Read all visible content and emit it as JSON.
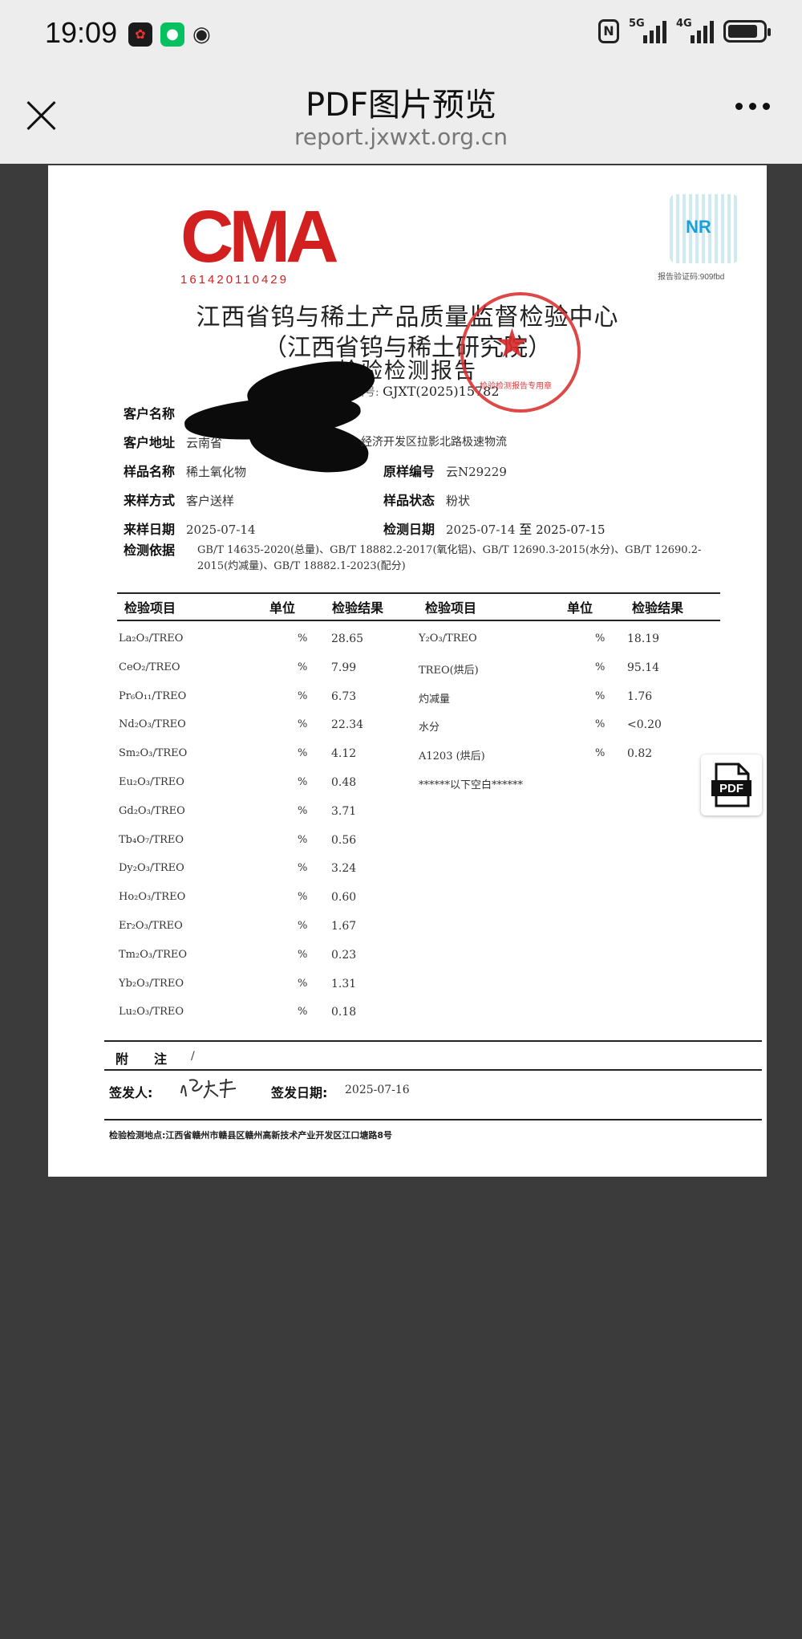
{
  "status_bar": {
    "time": "19:09",
    "network1": "5G",
    "network2": "4G",
    "battery_level": 0.85
  },
  "header": {
    "title": "PDF图片预览",
    "url": "report.jxwxt.org.cn"
  },
  "document": {
    "cma_logo": "CMA",
    "cma_number": "161420110429",
    "qr_code_label": "报告验证码:909fbd",
    "org_name": "江西省钨与稀土产品质量监督检验中心",
    "org_alt": "（江西省钨与稀土研究院）",
    "report_title": "检验检测报告",
    "report_no_label": "报告编号:",
    "report_no": "GJXT(2025)15782",
    "seal_text": "检验检测报告专用章",
    "client_name_label": "客户名称",
    "client_address_label": "客户地址",
    "client_address_visible": "云南省",
    "client_address_tail": "经济开发区拉影北路极速物流",
    "sample_name_label": "样品名称",
    "sample_name": "稀土氧化物",
    "original_no_label": "原样编号",
    "original_no": "云N29229",
    "sample_method_label": "来样方式",
    "sample_method": "客户送样",
    "sample_state_label": "样品状态",
    "sample_state": "粉状",
    "sample_date_label": "来样日期",
    "sample_date": "2025-07-14",
    "test_date_label": "检测日期",
    "test_date_from": "2025-07-14",
    "test_date_to_word": "至",
    "test_date_to": "2025-07-15",
    "basis_label": "检测依据",
    "basis_text": "GB/T 14635-2020(总量)、GB/T 18882.2-2017(氧化铝)、GB/T 12690.3-2015(水分)、GB/T 12690.2-2015(灼减量)、GB/T 18882.1-2023(配分)",
    "table_headers": {
      "item": "检验项目",
      "unit": "单位",
      "result": "检验结果"
    },
    "left_rows": [
      {
        "item": "La₂O₃/TREO",
        "unit": "%",
        "value": "28.65"
      },
      {
        "item": "CeO₂/TREO",
        "unit": "%",
        "value": "7.99"
      },
      {
        "item": "Pr₆O₁₁/TREO",
        "unit": "%",
        "value": "6.73"
      },
      {
        "item": "Nd₂O₃/TREO",
        "unit": "%",
        "value": "22.34"
      },
      {
        "item": "Sm₂O₃/TREO",
        "unit": "%",
        "value": "4.12"
      },
      {
        "item": "Eu₂O₃/TREO",
        "unit": "%",
        "value": "0.48"
      },
      {
        "item": "Gd₂O₃/TREO",
        "unit": "%",
        "value": "3.71"
      },
      {
        "item": "Tb₄O₇/TREO",
        "unit": "%",
        "value": "0.56"
      },
      {
        "item": "Dy₂O₃/TREO",
        "unit": "%",
        "value": "3.24"
      },
      {
        "item": "Ho₂O₃/TREO",
        "unit": "%",
        "value": "0.60"
      },
      {
        "item": "Er₂O₃/TREO",
        "unit": "%",
        "value": "1.67"
      },
      {
        "item": "Tm₂O₃/TREO",
        "unit": "%",
        "value": "0.23"
      },
      {
        "item": "Yb₂O₃/TREO",
        "unit": "%",
        "value": "1.31"
      },
      {
        "item": "Lu₂O₃/TREO",
        "unit": "%",
        "value": "0.18"
      }
    ],
    "right_rows": [
      {
        "item": "Y₂O₃/TREO",
        "unit": "%",
        "value": "18.19"
      },
      {
        "item": "TREO(烘后)",
        "unit": "%",
        "value": "95.14"
      },
      {
        "item": "灼减量",
        "unit": "%",
        "value": "1.76"
      },
      {
        "item": "水分",
        "unit": "%",
        "value": "<0.20"
      },
      {
        "item": "A1203 (烘后)",
        "unit": "%",
        "value": "0.82"
      },
      {
        "item": "******以下空白******",
        "unit": "",
        "value": ""
      }
    ],
    "note_label": "附　　注",
    "note_value": "/",
    "signer_label": "签发人:",
    "signer_signature": "曾庆平",
    "issue_date_label": "签发日期:",
    "issue_date": "2025-07-16",
    "address_label": "检验检测地点:",
    "address": "江西省赣州市赣县区赣州高新技术产业开发区江口塘路8号"
  },
  "pdf_badge": {
    "label": "PDF"
  }
}
